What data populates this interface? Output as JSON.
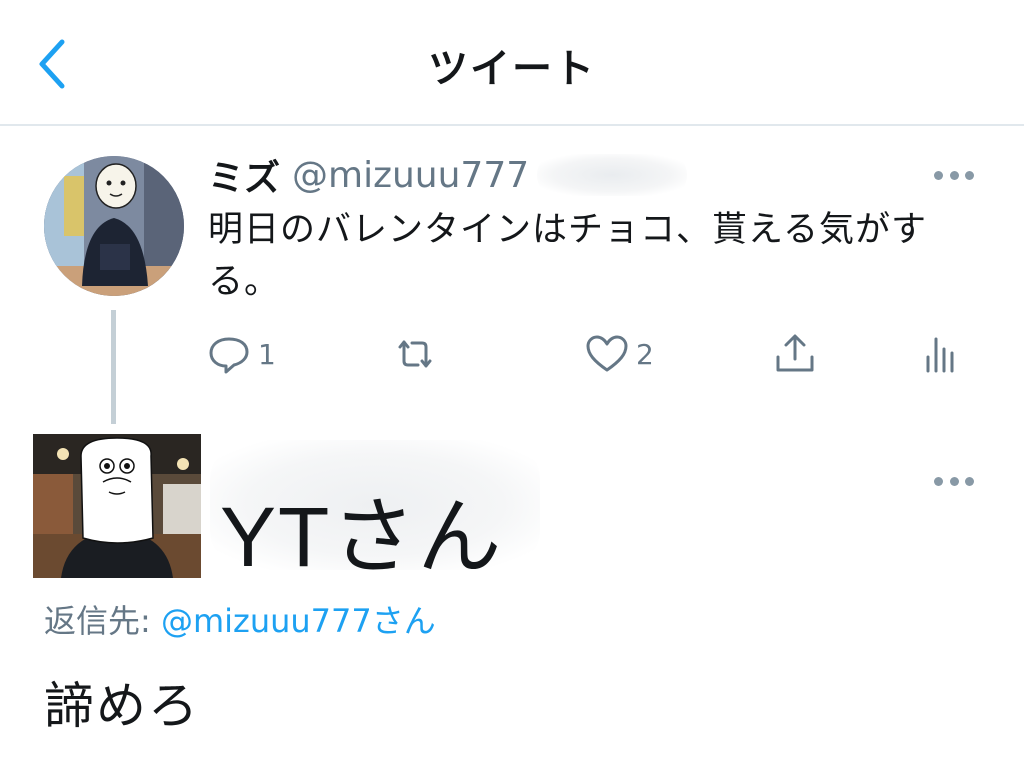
{
  "header": {
    "title": "ツイート",
    "back_icon": "chevron-left-icon"
  },
  "tweet": {
    "display_name": "ミズ",
    "handle": "@mizuuu777",
    "text": "明日のバレンタインはチョコ、貰える気がする。",
    "actions": {
      "reply_count": "1",
      "retweet_count": "",
      "like_count": "2"
    }
  },
  "reply": {
    "display_name": "YTさん",
    "reply_prefix": "返信先: ",
    "reply_handle": "@mizuuu777さん",
    "text": "諦めろ"
  },
  "colors": {
    "accent": "#1da1f2",
    "muted": "#657786",
    "text": "#14171a",
    "divider": "#e1e8ed"
  }
}
